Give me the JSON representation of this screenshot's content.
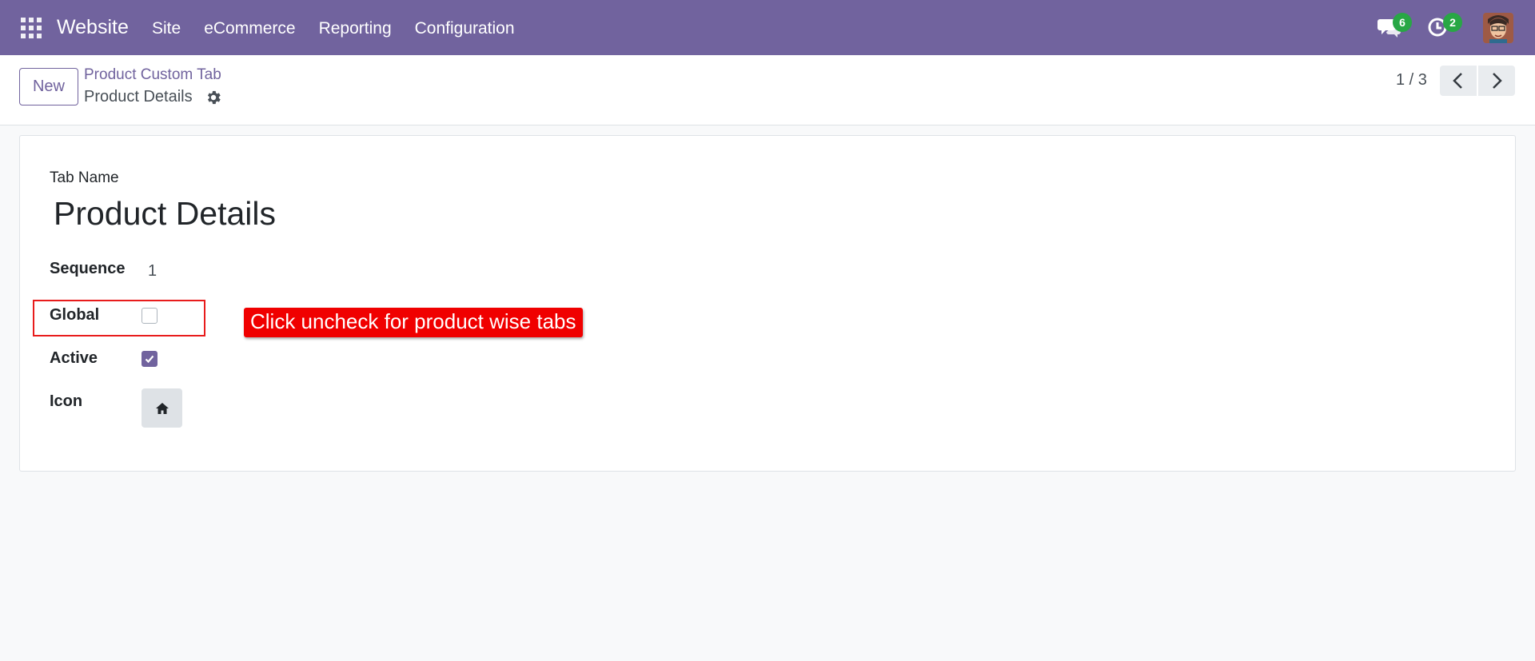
{
  "navbar": {
    "app_name": "Website",
    "menu": [
      "Site",
      "eCommerce",
      "Reporting",
      "Configuration"
    ],
    "messages_count": "6",
    "activities_count": "2",
    "color": "#71639e"
  },
  "control_panel": {
    "new_label": "New",
    "breadcrumb_parent": "Product Custom Tab",
    "breadcrumb_current": "Product Details",
    "pager": "1 / 3"
  },
  "form": {
    "tab_name_label": "Tab Name",
    "tab_name_value": "Product Details",
    "sequence_label": "Sequence",
    "sequence_value": "1",
    "global_label": "Global",
    "global_checked": false,
    "active_label": "Active",
    "active_checked": true,
    "icon_label": "Icon",
    "icon_name": "home-icon"
  },
  "annotation": {
    "callout_text": "Click uncheck for product wise tabs",
    "color": "#f00000"
  }
}
